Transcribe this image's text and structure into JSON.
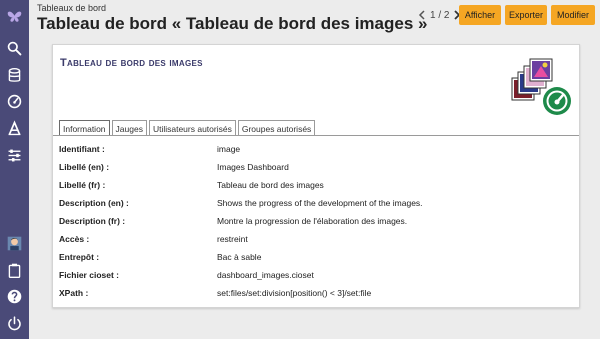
{
  "breadcrumb": "Tableaux de bord",
  "page_title": "Tableau de bord « Tableau de bord des images »",
  "pager": {
    "count": "1 / 2"
  },
  "toolbar": {
    "display_label": "Afficher",
    "export_label": "Exporter",
    "edit_label": "Modifier"
  },
  "colors": {
    "sidebar": "#4a4a78",
    "accent": "#f5a623",
    "title": "#3a3a6a"
  },
  "sidebar": {
    "logo_icon": "butterfly-icon",
    "items": [
      "search-icon",
      "database-icon",
      "gauge-icon",
      "text-icon",
      "sliders-icon"
    ],
    "bottom": [
      "avatar",
      "clipboard-icon",
      "help-icon",
      "power-icon"
    ]
  },
  "card": {
    "title": "Tableau de bord des images",
    "tabs": [
      "Information",
      "Jauges",
      "Utilisateurs autorisés",
      "Groupes autorisés"
    ],
    "active_tab": "Information",
    "fields": [
      {
        "label": "Identifiant :",
        "value": "image"
      },
      {
        "label": "Libellé (en) :",
        "value": "Images Dashboard"
      },
      {
        "label": "Libellé (fr) :",
        "value": "Tableau de bord des images"
      },
      {
        "label": "Description (en) :",
        "value": "Shows the progress of the development of the images."
      },
      {
        "label": "Description (fr) :",
        "value": "Montre la progression de l'élaboration des images."
      },
      {
        "label": "Accès :",
        "value": "restreint"
      },
      {
        "label": "Entrepôt :",
        "value": "Bac à sable"
      },
      {
        "label": "Fichier cioset :",
        "value": "dashboard_images.cioset"
      },
      {
        "label": "XPath :",
        "value": "set:files/set:division[position() < 3]/set:file"
      }
    ]
  }
}
